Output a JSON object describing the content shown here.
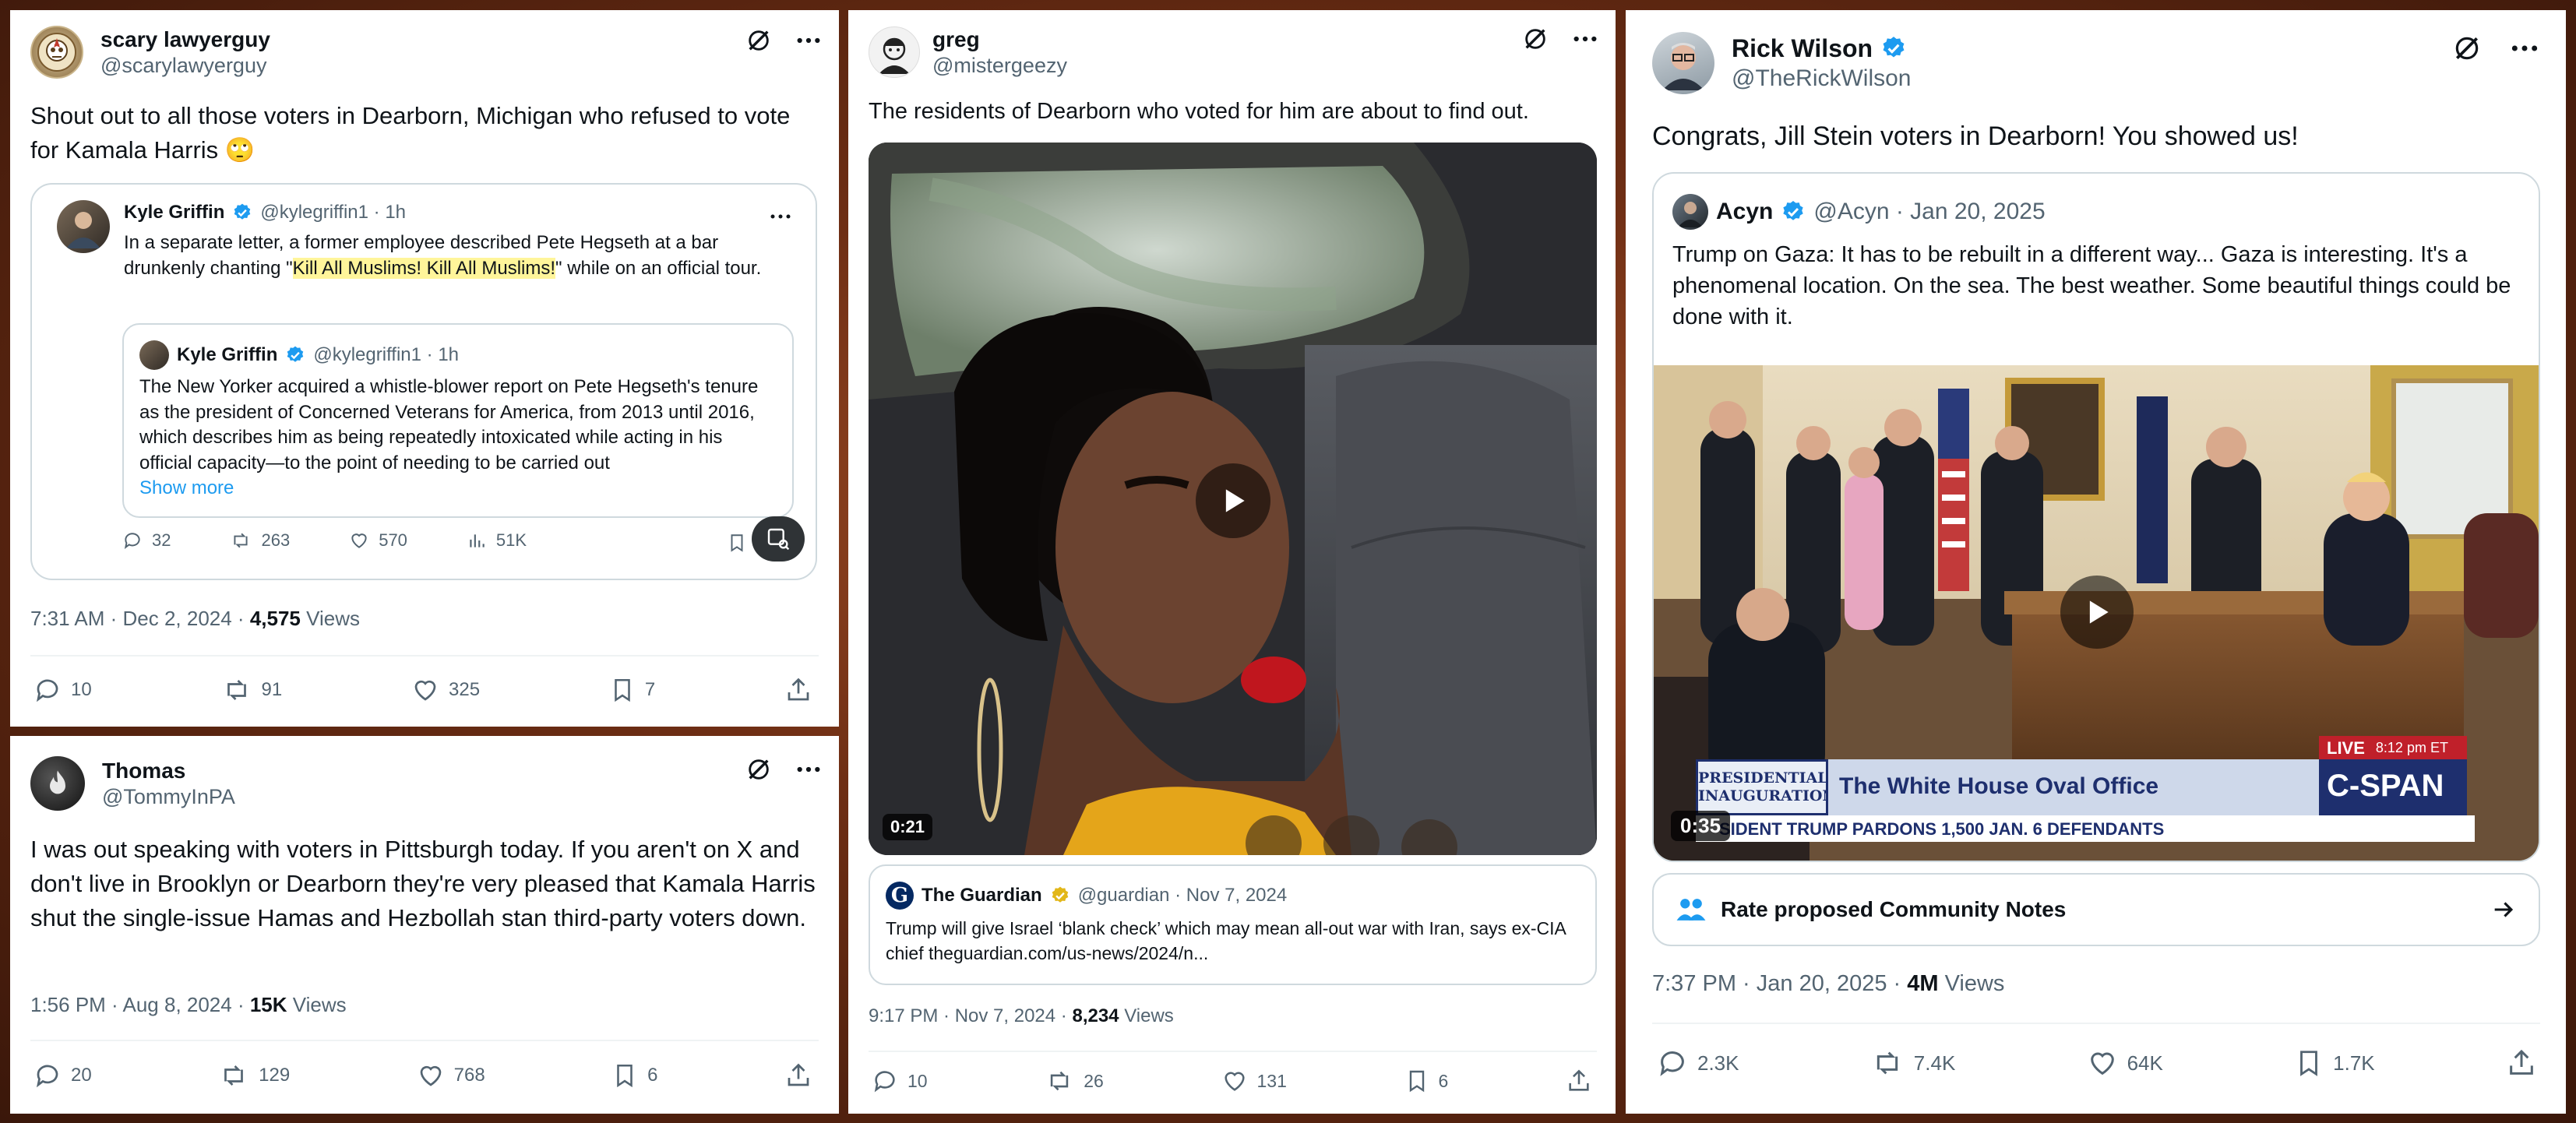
{
  "post1": {
    "name": "scary lawyerguy",
    "handle": "@scarylawyerguy",
    "text": "Shout out to all those voters in Dearborn, Michigan who refused to vote for Kamala Harris 🙄",
    "quote": {
      "name": "Kyle Griffin",
      "handle": "@kylegriffin1 · 1h",
      "text_pre": "In a separate letter, a former employee described Pete Hegseth at a bar drunkenly chanting \"",
      "text_hl": "Kill All Muslims! Kill All Muslims!",
      "text_post": "\" while on an official tour.",
      "inner": {
        "name": "Kyle Griffin",
        "handle": "@kylegriffin1 · 1h",
        "text": "The New Yorker acquired a whistle-blower report on Pete Hegseth's tenure as the president of Concerned Veterans for America, from 2013 until 2016, which describes him as being repeatedly intoxicated while acting in his official capacity—to the point of needing to be carried out",
        "show_more": "Show more"
      },
      "stats": {
        "replies": "32",
        "reposts": "263",
        "likes": "570",
        "views": "51K"
      }
    },
    "meta_time": "7:31 AM · Dec 2, 2024 · ",
    "meta_views": "4,575",
    "meta_views_label": " Views",
    "actions": {
      "replies": "10",
      "reposts": "91",
      "likes": "325",
      "bookmarks": "7"
    }
  },
  "post2": {
    "name": "Thomas",
    "handle": "@TommyInPA",
    "text": "I was out speaking with voters in Pittsburgh today. If you aren't on X and don't live in Brooklyn or Dearborn they're very pleased that Kamala Harris shut the single-issue Hamas and Hezbollah stan third-party voters down.",
    "meta_time": "1:56 PM · Aug 8, 2024 · ",
    "meta_views": "15K",
    "meta_views_label": " Views",
    "actions": {
      "replies": "20",
      "reposts": "129",
      "likes": "768",
      "bookmarks": "6"
    }
  },
  "post3": {
    "name": "greg",
    "handle": "@mistergeezy",
    "text": "The residents of Dearborn who voted for him are about to find out.",
    "video_duration": "0:21",
    "link": {
      "source": "The Guardian",
      "handle": "@guardian · Nov 7, 2024",
      "text": "Trump will give Israel ‘blank check’ which may mean all-out war with Iran, says ex-CIA chief theguardian.com/us-news/2024/n..."
    },
    "meta_time": "9:17 PM · Nov 7, 2024 · ",
    "meta_views": "8,234",
    "meta_views_label": " Views",
    "actions": {
      "replies": "10",
      "reposts": "26",
      "likes": "131",
      "bookmarks": "6"
    }
  },
  "post4": {
    "name": "Rick Wilson",
    "handle": "@TheRickWilson",
    "text": "Congrats, Jill Stein voters in Dearborn! You showed us!",
    "quote": {
      "name": "Acyn",
      "handle": "@Acyn · Jan 20, 2025",
      "text": "Trump on Gaza: It has to be rebuilt in a different way... Gaza is interesting. It's a phenomenal location. On the sea. The best weather. Some beautiful things could be done with it.",
      "video_duration": "0:35",
      "chyron": {
        "left_line1": "PRESIDENTIAL",
        "left_line2": "INAUGURATION",
        "title": "The White House Oval Office",
        "live": "LIVE",
        "time": "8:12 pm ET",
        "network": "C-SPAN",
        "ticker": "SIDENT TRUMP PARDONS 1,500 JAN. 6 DEFENDANTS"
      }
    },
    "community_notes": "Rate proposed Community Notes",
    "meta_time": "7:37 PM · Jan 20, 2025 · ",
    "meta_views": "4M",
    "meta_views_label": " Views",
    "actions": {
      "replies": "2.3K",
      "reposts": "7.4K",
      "likes": "64K",
      "bookmarks": "1.7K"
    }
  },
  "colors": {
    "verified": "#1d9bf0",
    "gold": "#e2b719",
    "link": "#1d9bf0",
    "muted": "#536471"
  }
}
